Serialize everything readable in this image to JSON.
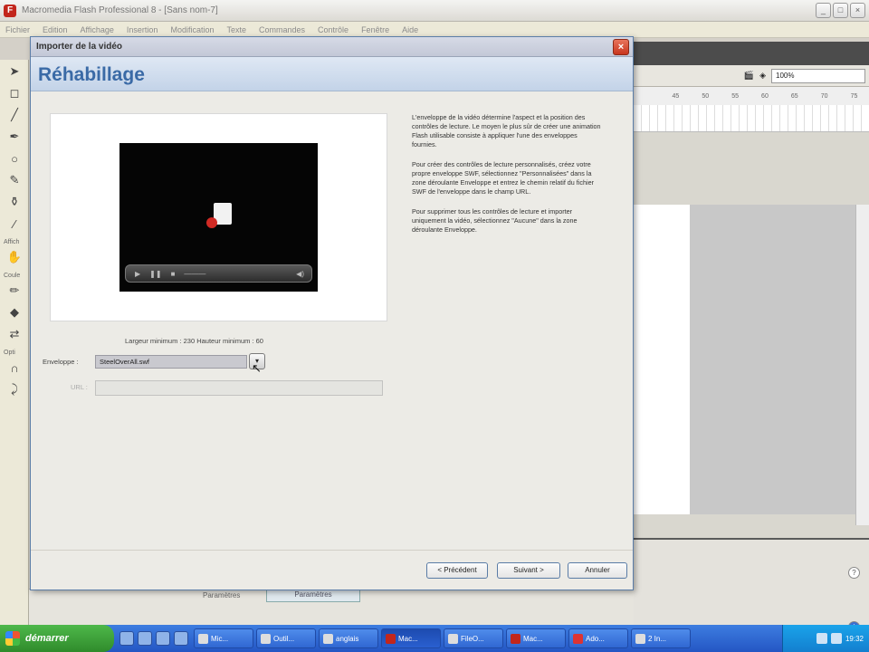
{
  "app": {
    "title": "Macromedia Flash Professional 8 - [Sans nom-7]",
    "logo": "F",
    "menus": [
      "Fichier",
      "Edition",
      "Affichage",
      "Insertion",
      "Modification",
      "Texte",
      "Commandes",
      "Contrôle",
      "Fenêtre",
      "Aide"
    ],
    "window_buttons": [
      "_",
      "□",
      "×"
    ]
  },
  "toolbox": {
    "label_view": "Affich",
    "label_colors": "Coule",
    "label_options": "Opti"
  },
  "right_panel": {
    "zoom": "100%",
    "ruler_ticks": [
      "45",
      "50",
      "55",
      "60",
      "65",
      "70",
      "75"
    ]
  },
  "bottom_panel": {
    "label": "Paramètres",
    "button": "Paramètres"
  },
  "dialog": {
    "title": "Importer de la vidéo",
    "close": "×",
    "heading": "Réhabillage",
    "description": [
      "L'enveloppe de la vidéo détermine l'aspect et la position des contrôles de lecture. Le moyen le plus sûr de créer une animation Flash utilisable consiste à appliquer l'une des enveloppes fournies.",
      "Pour créer des contrôles de lecture personnalisés, créez votre propre enveloppe SWF, sélectionnez \"Personnalisées\" dans la zone déroulante Enveloppe et entrez le chemin relatif du fichier SWF de l'enveloppe dans le champ URL.",
      "Pour supprimer tous les contrôles de lecture et importer uniquement la vidéo, sélectionnez \"Aucune\" dans la zone déroulante Enveloppe."
    ],
    "size_info": "Largeur minimum : 230  Hauteur minimum : 60",
    "skin_label": "Enveloppe :",
    "skin_value": "SteelOverAll.swf",
    "url_label": "URL :",
    "url_value": "",
    "buttons": {
      "previous": "< Précédent",
      "next": "Suivant >",
      "cancel": "Annuler"
    }
  },
  "taskbar": {
    "start": "démarrer",
    "tasks": [
      "Mic...",
      "Outil...",
      "anglais",
      "Mac...",
      "FileO...",
      "Mac...",
      "Ado...",
      "2 In..."
    ],
    "clock": "19:32"
  }
}
